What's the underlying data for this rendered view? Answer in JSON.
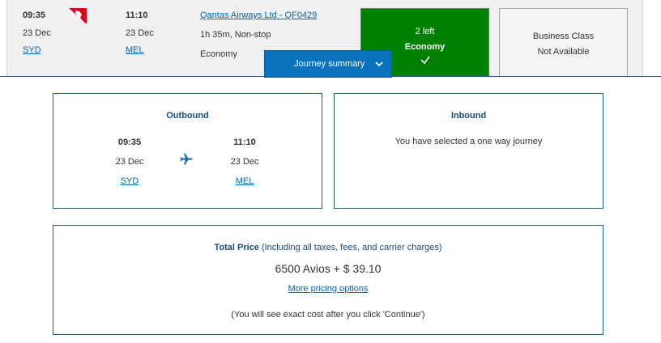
{
  "flight": {
    "departure": {
      "time": "09:35",
      "date": "23 Dec",
      "airport": "SYD"
    },
    "arrival": {
      "time": "11:10",
      "date": "23 Dec",
      "airport": "MEL"
    },
    "airline_link": "Qantas Airways Ltd - QF0429",
    "duration": "1h 35m, Non-stop",
    "cabin": "Economy",
    "airline_logo_icon": "qantas-kangaroo-logo"
  },
  "fares": {
    "economy": {
      "seats_left": "2 left",
      "cabin": "Economy",
      "selected_icon": "check-icon"
    },
    "business": {
      "cabin": "Business Class",
      "status": "Not Available"
    }
  },
  "journey_summary": {
    "button_label": "Journey summary"
  },
  "outbound": {
    "title": "Outbound",
    "departure": {
      "time": "09:35",
      "date": "23 Dec",
      "airport": "SYD"
    },
    "arrival": {
      "time": "11:10",
      "date": "23 Dec",
      "airport": "MEL"
    }
  },
  "inbound": {
    "title": "Inbound",
    "message": "You have selected a one way journey"
  },
  "price": {
    "label": "Total Price",
    "detail": " (Including all taxes, fees, and carrier charges)",
    "value": "6500 Avios + $ 39.10",
    "more_options": "More pricing options",
    "note": "(You will see exact cost after you click 'Continue')"
  },
  "colors": {
    "economy_selected": "#008000",
    "primary_button": "#0a72bd",
    "link": "#0a62a8",
    "heading_blue": "#1a4c7c",
    "qantas_red": "#e0001b"
  }
}
